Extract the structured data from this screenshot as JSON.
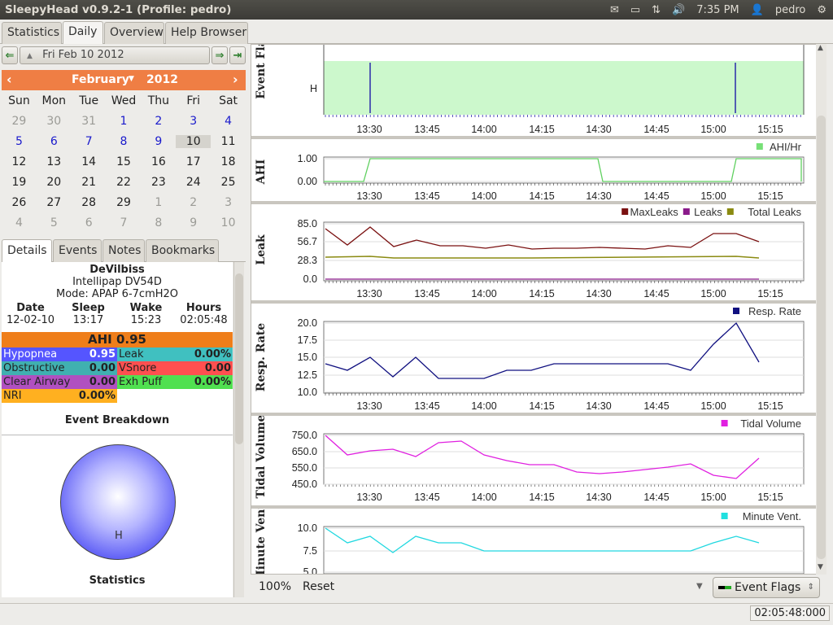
{
  "topbar": {
    "title": "SleepyHead v0.9.2-1  (Profile: pedro)",
    "time": "7:35 PM",
    "user": "pedro"
  },
  "tabs": [
    "Statistics",
    "Daily",
    "Overview",
    "Help Browser"
  ],
  "nav": {
    "date": "Fri Feb 10 2012"
  },
  "calendar": {
    "month": "February",
    "year": "2012",
    "weekdays": [
      "Sun",
      "Mon",
      "Tue",
      "Wed",
      "Thu",
      "Fri",
      "Sat"
    ],
    "rows": [
      [
        "29",
        "30",
        "31",
        "1",
        "2",
        "3",
        "4"
      ],
      [
        "5",
        "6",
        "7",
        "8",
        "9",
        "10",
        "11"
      ],
      [
        "12",
        "13",
        "14",
        "15",
        "16",
        "17",
        "18"
      ],
      [
        "19",
        "20",
        "21",
        "22",
        "23",
        "24",
        "25"
      ],
      [
        "26",
        "27",
        "28",
        "29",
        "1",
        "2",
        "3"
      ],
      [
        "4",
        "5",
        "6",
        "7",
        "8",
        "9",
        "10"
      ]
    ]
  },
  "subtabs": [
    "Details",
    "Events",
    "Notes",
    "Bookmarks"
  ],
  "details": {
    "brand": "DeVilbiss",
    "model": "Intellipap DV54D",
    "mode": "Mode: APAP 6-7cmH2O",
    "headers": [
      "Date",
      "Sleep",
      "Wake",
      "Hours"
    ],
    "values": [
      "12-02-10",
      "13:17",
      "15:23",
      "02:05:48"
    ],
    "ahi": "AHI 0.95",
    "events": [
      {
        "label": "Hypopnea",
        "value": "0.95",
        "color": "#5555ff"
      },
      {
        "label": "Leak",
        "value": "0.00%",
        "color": "#40c0c0"
      },
      {
        "label": "Obstructive",
        "value": "0.00",
        "color": "#40b0b0"
      },
      {
        "label": "VSnore",
        "value": "0.00",
        "color": "#ff5050"
      },
      {
        "label": "Clear Airway",
        "value": "0.00",
        "color": "#b050c0"
      },
      {
        "label": "Exh Puff",
        "value": "0.00%",
        "color": "#50e050"
      },
      {
        "label": "NRI",
        "value": "0.00%",
        "color": "#ffb020"
      }
    ],
    "breakdown": "Event Breakdown",
    "pie_label": "H",
    "stats": "Statistics"
  },
  "graphs": {
    "times": [
      "13:30",
      "13:45",
      "14:00",
      "14:15",
      "14:30",
      "14:45",
      "15:00",
      "15:15"
    ],
    "event_flags": {
      "title": "Event Fla",
      "label": "H"
    },
    "ahi": {
      "title": "AHI",
      "legend": "AHI/Hr",
      "y": [
        "1.00",
        "0.00"
      ]
    },
    "leak": {
      "title": "Leak",
      "legend": [
        "MaxLeaks",
        "Leaks",
        "Total Leaks"
      ],
      "y": [
        "85.0",
        "56.7",
        "28.3",
        "0.0"
      ]
    },
    "resp": {
      "title": "Resp. Rate",
      "legend": "Resp. Rate",
      "y": [
        "20.0",
        "17.5",
        "15.0",
        "12.5",
        "10.0"
      ]
    },
    "tidal": {
      "title": "Tidal Volume",
      "legend": "Tidal Volume",
      "y": [
        "750.0",
        "650.0",
        "550.0",
        "450.0"
      ]
    },
    "minute": {
      "title": "Minute Vent.",
      "legend": "Minute Vent.",
      "y": [
        "10.0",
        "7.5",
        "5.0"
      ]
    }
  },
  "bottombar": {
    "zoom": "100%",
    "reset": "Reset",
    "combo": "Event Flags"
  },
  "statusbar": {
    "time": "02:05:48:000"
  }
}
